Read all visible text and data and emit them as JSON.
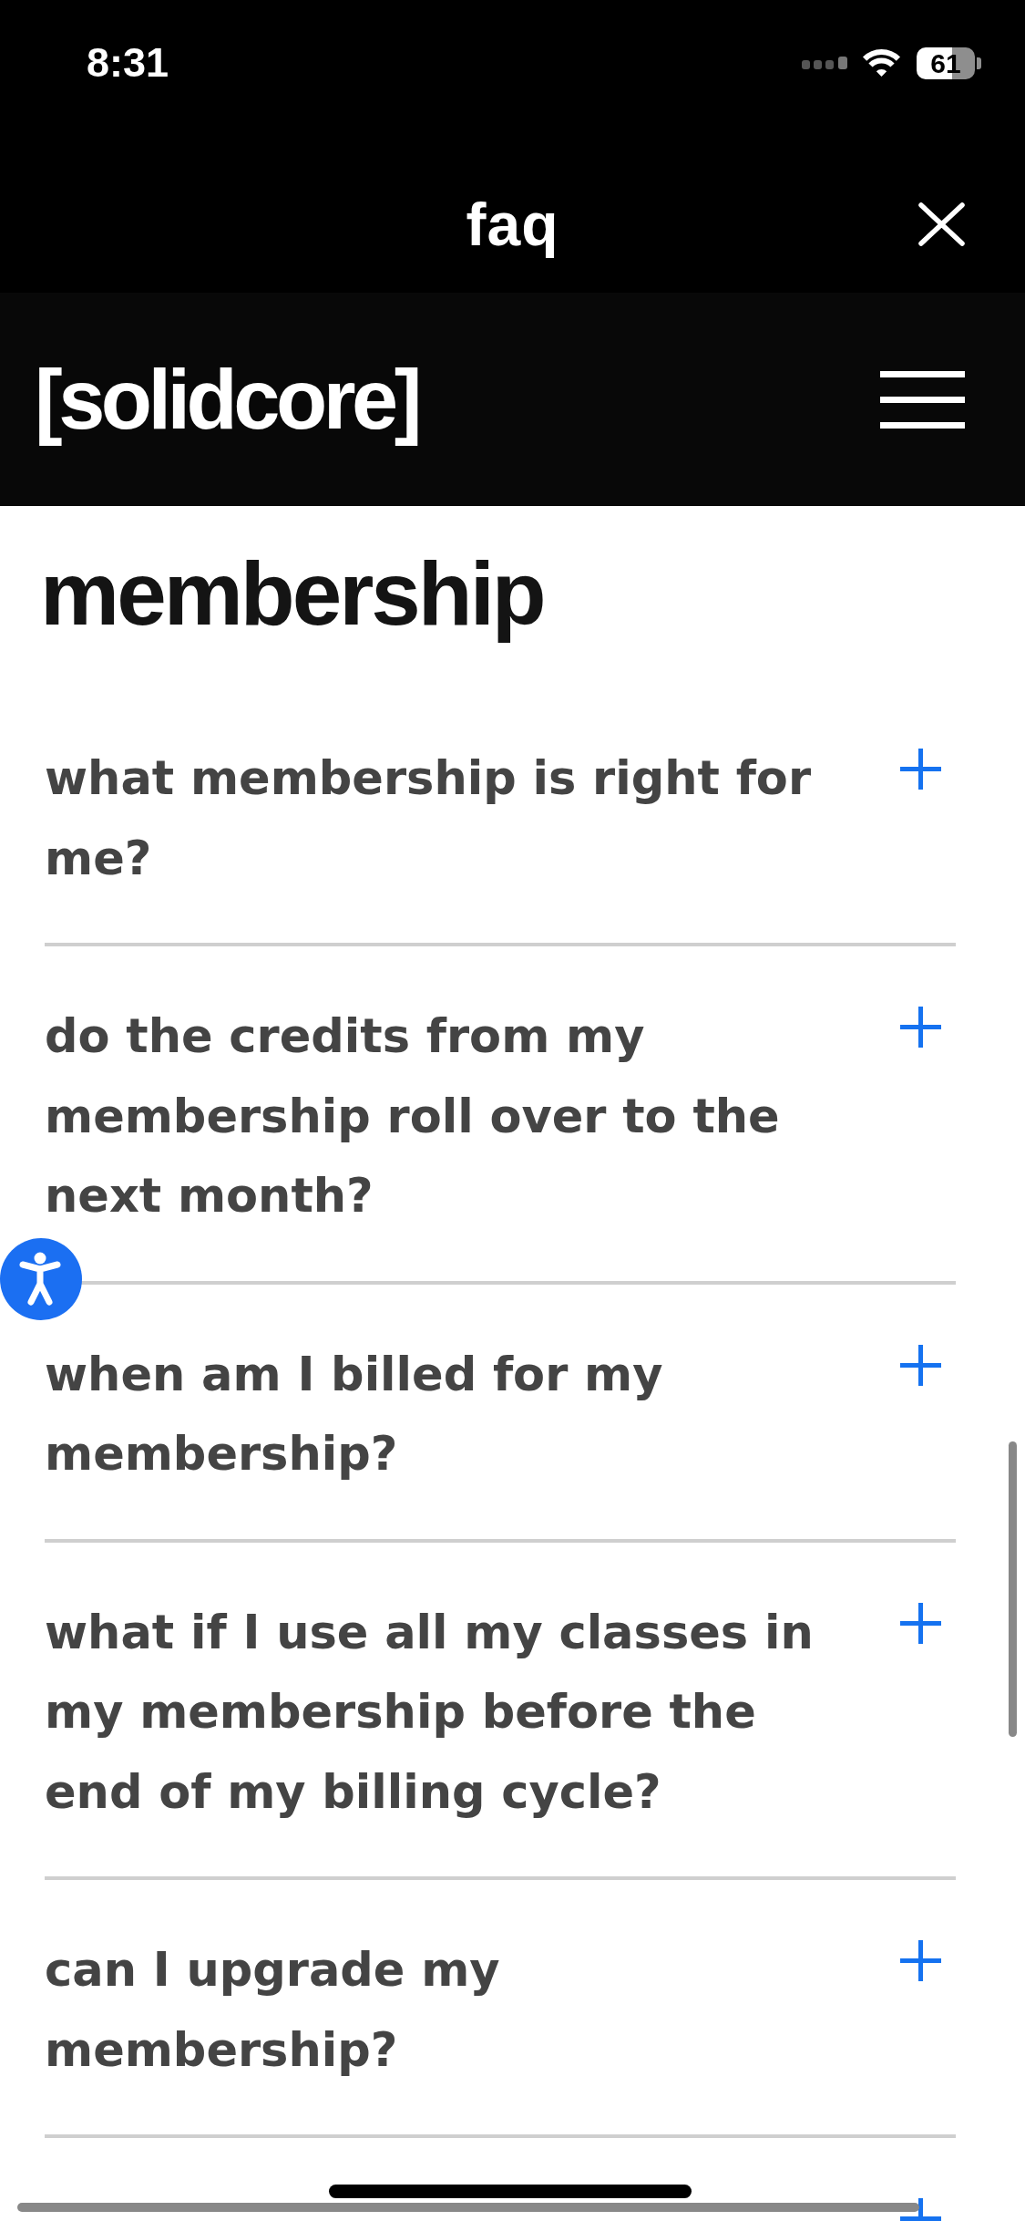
{
  "status_bar": {
    "time": "8:31",
    "battery": "61"
  },
  "title_bar": {
    "title": "faq"
  },
  "header": {
    "logo": "[solidcore]"
  },
  "section": {
    "heading": "membership",
    "questions": [
      {
        "text": "what membership is right for me?",
        "expanded": false
      },
      {
        "text": "do the credits from my membership roll over to the next month?",
        "expanded": false
      },
      {
        "text": "when am I billed for my membership?",
        "expanded": false
      },
      {
        "text": "what if I use all my classes in my membership before the end of my billing cycle?",
        "expanded": false
      },
      {
        "text": "can I upgrade my membership?",
        "expanded": false
      },
      {
        "expanded": false
      }
    ]
  }
}
